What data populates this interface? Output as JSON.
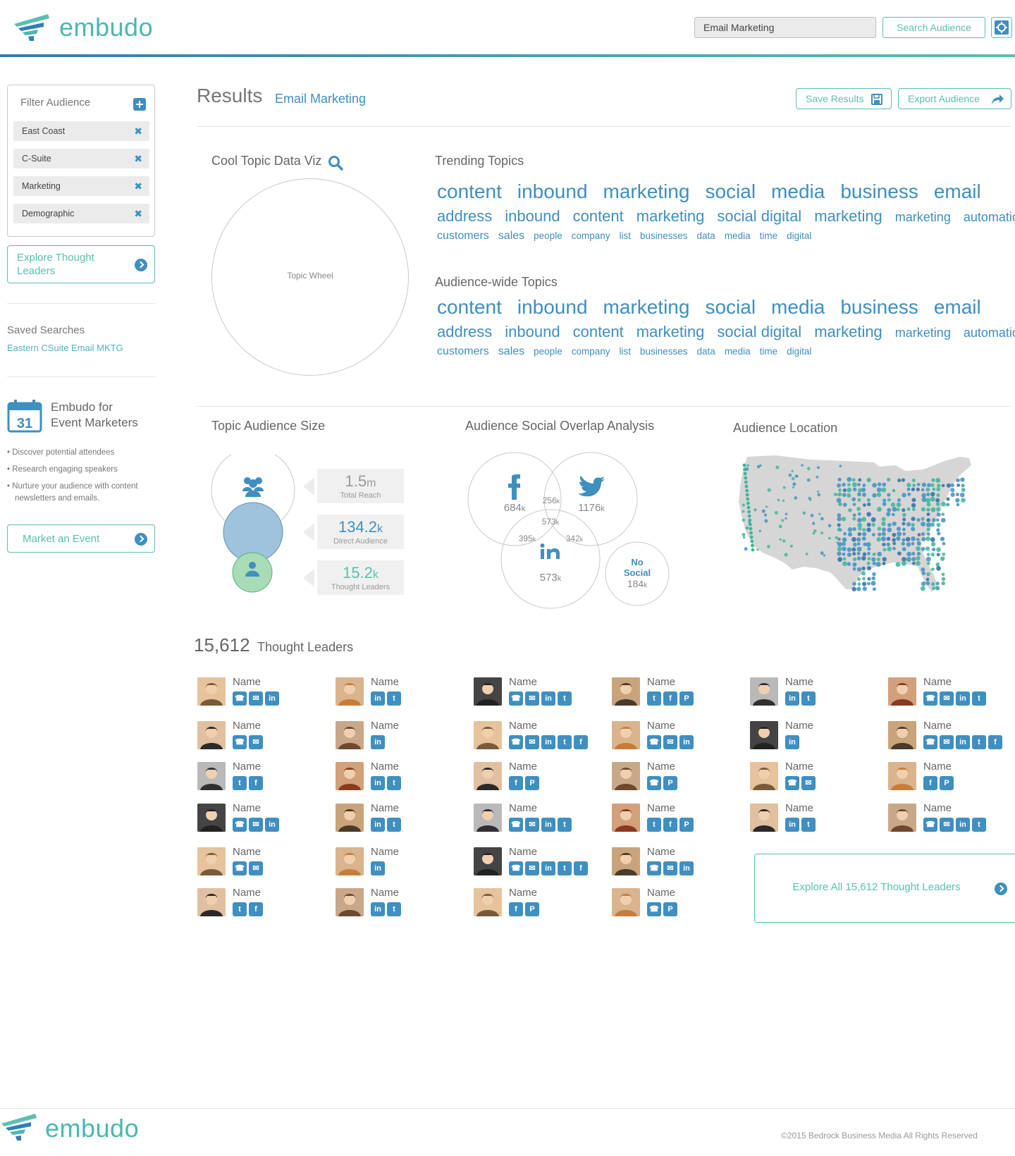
{
  "header": {
    "logo_text": "embudo",
    "search_value": "Email Marketing",
    "search_button": "Search Audience",
    "settings_icon": "gear-icon"
  },
  "sidebar": {
    "filter_title": "Filter Audience",
    "filters": [
      "East Coast",
      "C-Suite",
      "Marketing",
      "Demographic"
    ],
    "explore_leaders": "Explore Thought Leaders",
    "saved_searches_title": "Saved Searches",
    "saved_search_item": "Eastern CSuite Email MKTG",
    "event": {
      "calendar_day": "31",
      "title_line1": "Embudo for",
      "title_line2": "Event Marketers",
      "bullets": [
        "Discover potential attendees",
        "Research engaging speakers",
        "Nurture your audience with content newsletters and emails."
      ],
      "button": "Market an Event"
    }
  },
  "results": {
    "title": "Results",
    "query": "Email Marketing",
    "save_button": "Save Results",
    "export_button": "Export Audience"
  },
  "topic_viz": {
    "title": "Cool Topic Data Viz",
    "wheel_label": "Topic Wheel"
  },
  "trending": {
    "title": "Trending Topics",
    "row1": [
      "content",
      "inbound",
      "marketing",
      "social",
      "media",
      "business",
      "email"
    ],
    "row2": [
      "address",
      "inbound",
      "content",
      "marketing",
      "social digital",
      "marketing",
      "marketing",
      "automation"
    ],
    "row3": [
      "customers",
      "sales",
      "people",
      "company",
      "list",
      "businesses",
      "data",
      "media",
      "time",
      "digital"
    ]
  },
  "audience_wide": {
    "title": "Audience-wide Topics",
    "row1": [
      "content",
      "inbound",
      "marketing",
      "social",
      "media",
      "business",
      "email"
    ],
    "row2": [
      "address",
      "inbound",
      "content",
      "marketing",
      "social digital",
      "marketing",
      "marketing",
      "automation"
    ],
    "row3": [
      "customers",
      "sales",
      "people",
      "company",
      "list",
      "businesses",
      "data",
      "media",
      "time",
      "digital"
    ]
  },
  "audience_size": {
    "title": "Topic Audience Size",
    "stats": [
      {
        "value": "1.5",
        "unit": "m",
        "label": "Total Reach"
      },
      {
        "value": "134.2",
        "unit": "k",
        "label": "Direct Audience"
      },
      {
        "value": "15.2",
        "unit": "k",
        "label": "Thought Leaders"
      }
    ]
  },
  "overlap": {
    "title": "Audience Social Overlap Analysis",
    "facebook": {
      "value": "684",
      "unit": "k"
    },
    "twitter": {
      "value": "1176",
      "unit": "k"
    },
    "linkedin": {
      "value": "573",
      "unit": "k"
    },
    "fb_tw": {
      "value": "256",
      "unit": "k"
    },
    "all": {
      "value": "573",
      "unit": "k"
    },
    "fb_li": {
      "value": "395",
      "unit": "k"
    },
    "tw_li": {
      "value": "342",
      "unit": "k"
    },
    "no_social": {
      "line1": "No",
      "line2": "Social",
      "value": "184",
      "unit": "k"
    }
  },
  "location": {
    "title": "Audience Location"
  },
  "leaders": {
    "count": "15,612",
    "label": "Thought Leaders",
    "item_name": "Name",
    "explore_all": "Explore All 15,612 Thought Leaders",
    "grid": [
      [
        [
          "phone",
          "email",
          "linkedin"
        ],
        [
          "linkedin",
          "twitter"
        ],
        [
          "phone",
          "email",
          "linkedin",
          "twitter"
        ],
        [
          "twitter",
          "facebook",
          "pinterest"
        ],
        [
          "linkedin",
          "twitter"
        ],
        [
          "phone",
          "email",
          "linkedin",
          "twitter"
        ]
      ],
      [
        [
          "phone",
          "email"
        ],
        [
          "linkedin"
        ],
        [
          "phone",
          "email",
          "linkedin",
          "twitter",
          "facebook"
        ],
        [
          "phone",
          "email",
          "linkedin"
        ],
        [
          "linkedin"
        ],
        [
          "phone",
          "email",
          "linkedin",
          "twitter",
          "facebook"
        ]
      ],
      [
        [
          "twitter",
          "facebook"
        ],
        [
          "linkedin",
          "twitter"
        ],
        [
          "facebook",
          "pinterest"
        ],
        [
          "phone",
          "pinterest"
        ],
        [
          "phone",
          "email"
        ],
        [
          "facebook",
          "pinterest"
        ]
      ],
      [
        [
          "phone",
          "email",
          "linkedin"
        ],
        [
          "linkedin",
          "twitter"
        ],
        [
          "phone",
          "email",
          "linkedin",
          "twitter"
        ],
        [
          "twitter",
          "facebook",
          "pinterest"
        ],
        [
          "linkedin",
          "twitter"
        ],
        [
          "phone",
          "email",
          "linkedin",
          "twitter"
        ]
      ],
      [
        [
          "phone",
          "email"
        ],
        [
          "linkedin"
        ],
        [
          "phone",
          "email",
          "linkedin",
          "twitter",
          "facebook"
        ],
        [
          "phone",
          "email",
          "linkedin"
        ]
      ],
      [
        [
          "twitter",
          "facebook"
        ],
        [
          "linkedin",
          "twitter"
        ],
        [
          "facebook",
          "pinterest"
        ],
        [
          "phone",
          "pinterest"
        ]
      ]
    ]
  },
  "footer": {
    "logo_text": "embudo",
    "copyright": "©2015 Bedrock Business Media All Rights Reserved"
  },
  "colors": {
    "accent_teal": "#5bbfae",
    "accent_blue": "#3f8fc0",
    "map_land": "#d6d6d6"
  }
}
